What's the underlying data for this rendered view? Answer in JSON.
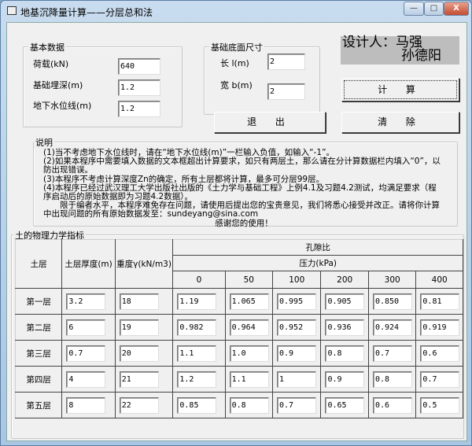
{
  "window": {
    "title": "地基沉降量计算——分层总和法",
    "minimize": "—",
    "maximize": "□",
    "close": "X"
  },
  "basic": {
    "title": "基本数据",
    "fields": [
      {
        "label": "荷载(kN)",
        "value": "640"
      },
      {
        "label": "基础埋深(m)",
        "value": "1.2"
      },
      {
        "label": "地下水位线(m)",
        "value": "1.2"
      }
    ]
  },
  "foundation": {
    "title": "基础底面尺寸",
    "fields": [
      {
        "label": "长 l(m)",
        "value": "2"
      },
      {
        "label": "宽 b(m)",
        "value": "2"
      }
    ]
  },
  "designer": {
    "line1": "设计人：马强",
    "line2": "孙德阳"
  },
  "buttons": {
    "calc": "计 算",
    "exit": "退 出",
    "clear": "清 除"
  },
  "notes": {
    "title": "说明",
    "lines": [
      "(1)当不考虑地下水位线时，请在“地下水位线(m)”一栏输入负值，如输入“-1”。",
      "(2)如果本程序中需要填入数据的文本框超出计算要求，如只有两层土，那么请在分计算数据栏内填入“0”，以防出现错误。",
      "(3)本程序不考虑计算深度Zn的确定，所有土层都将计算，最多可分层99层。",
      "(4)本程序已经过武汉理工大学出版社出版的《土力学与基础工程》上例4.1及习题4.2测试，均满足要求（程序启动后的原始数据即为习题4.2数据）。",
      "　　限于编者水平，本程序难免存在问题，请使用后提出您的宝贵意见，我们将悉心接受并改正。请将你计算中出现问题的所有原始数据发至：sundeyang@sina.com",
      "感谢您的使用！"
    ]
  },
  "soil": {
    "title": "土的物理力学指标",
    "headers": {
      "layer": "土层",
      "thickness": "土层厚度(m)",
      "weight": "重度γ(kN/m3)",
      "void": "孔隙比",
      "pressure": "压力(kPa)",
      "pressures": [
        "0",
        "50",
        "100",
        "200",
        "300",
        "400"
      ]
    },
    "rows": [
      {
        "name": "第一层",
        "thickness": "3.2",
        "weight": "18",
        "e": [
          "1.19",
          "1.065",
          "0.995",
          "0.905",
          "0.850",
          "0.81"
        ]
      },
      {
        "name": "第二层",
        "thickness": "6",
        "weight": "19",
        "e": [
          "0.982",
          "0.964",
          "0.952",
          "0.936",
          "0.924",
          "0.919"
        ]
      },
      {
        "name": "第三层",
        "thickness": "0.7",
        "weight": "20",
        "e": [
          "1.1",
          "1.0",
          "0.9",
          "0.8",
          "0.7",
          "0.6"
        ]
      },
      {
        "name": "第四层",
        "thickness": "4",
        "weight": "21",
        "e": [
          "1.2",
          "1.1",
          "1",
          "0.9",
          "0.8",
          "0.7"
        ]
      },
      {
        "name": "第五层",
        "thickness": "8",
        "weight": "22",
        "e": [
          "0.85",
          "0.8",
          "0.7",
          "0.65",
          "0.6",
          "0.5"
        ]
      }
    ]
  }
}
